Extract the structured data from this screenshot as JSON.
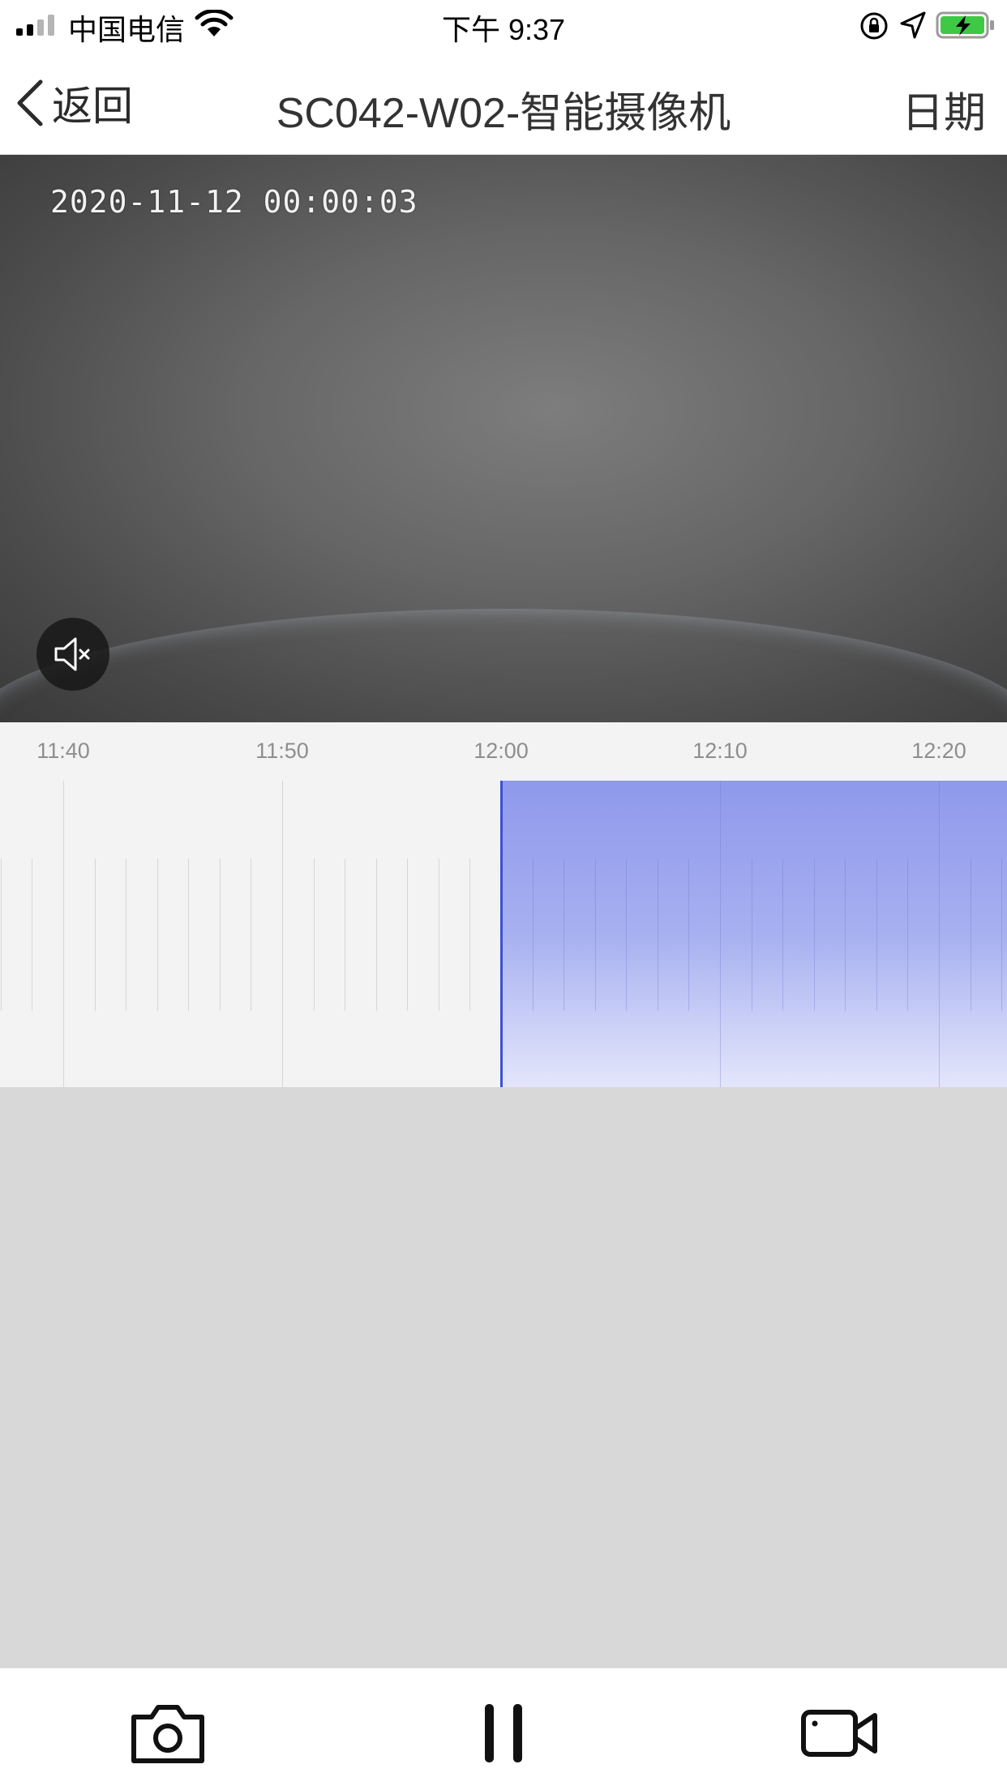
{
  "status_bar": {
    "carrier": "中国电信",
    "time": "下午 9:37",
    "icons": [
      "signal-icon",
      "wifi-icon",
      "orientation-lock-icon",
      "location-icon",
      "battery-charging-icon"
    ]
  },
  "nav": {
    "back_label": "返回",
    "title": "SC042-W02-智能摄像机",
    "right_label": "日期"
  },
  "video": {
    "timestamp": "2020-11-12  00:00:03",
    "mute_icon": "speaker-muted-icon"
  },
  "timeline": {
    "labels": [
      "11:40",
      "11:50",
      "12:00",
      "12:10",
      "12:20"
    ],
    "recording_start": "12:00",
    "recording_color": "#8e99ec",
    "cursor_color": "#3c50d6"
  },
  "toolbar": {
    "buttons": [
      "camera-icon",
      "pause-icon",
      "video-record-icon"
    ]
  }
}
